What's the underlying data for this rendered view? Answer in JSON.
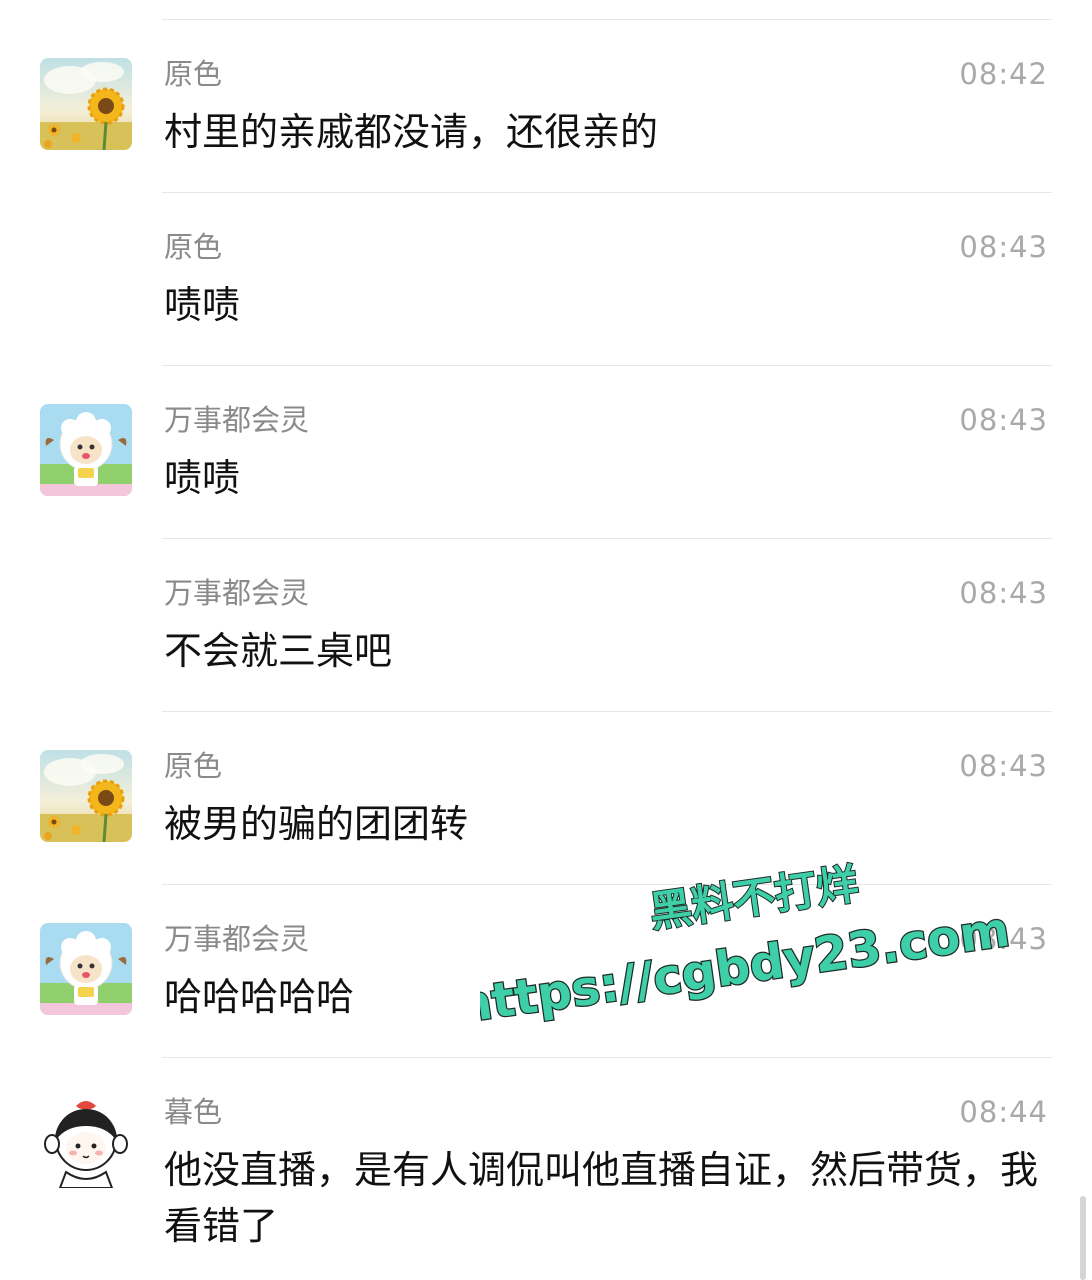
{
  "messages": [
    {
      "sender": "原色",
      "time": "08:42",
      "text": "村里的亲戚都没请，还很亲的",
      "avatar": "sunflower"
    },
    {
      "sender": "原色",
      "time": "08:43",
      "text": "啧啧",
      "avatar": ""
    },
    {
      "sender": "万事都会灵",
      "time": "08:43",
      "text": "啧啧",
      "avatar": "lamb"
    },
    {
      "sender": "万事都会灵",
      "time": "08:43",
      "text": "不会就三桌吧",
      "avatar": ""
    },
    {
      "sender": "原色",
      "time": "08:43",
      "text": "被男的骗的团团转",
      "avatar": "sunflower"
    },
    {
      "sender": "万事都会灵",
      "time": "08:43",
      "text": "哈哈哈哈哈",
      "avatar": "lamb"
    },
    {
      "sender": "暮色",
      "time": "08:44",
      "text": "他没直播，是有人调侃叫他直播自证，然后带货，我看错了",
      "avatar": "chick-girl"
    }
  ],
  "watermark": {
    "line1": "黑料不打烊",
    "line2": "https://cgbdy23.com",
    "color": "#3ecfa8"
  }
}
